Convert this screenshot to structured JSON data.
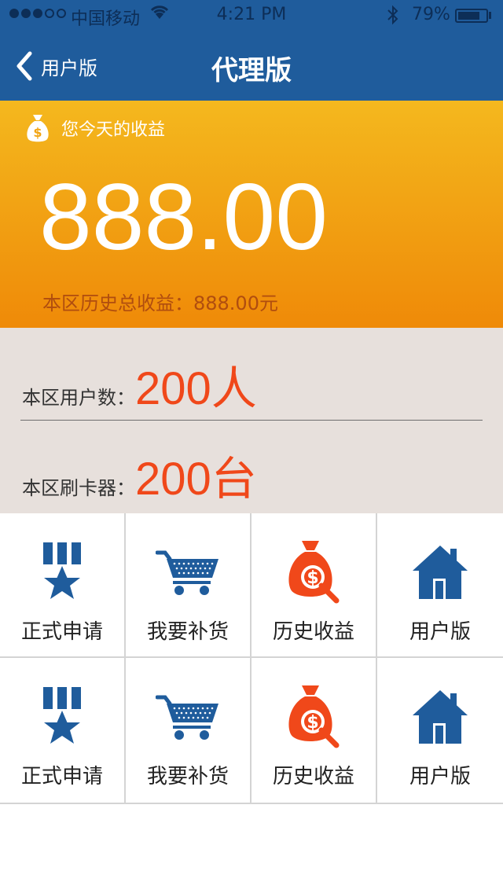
{
  "status": {
    "carrier": "中国移动",
    "time": "4:21 PM",
    "battery": "79%",
    "battery_level": 0.79,
    "signal_bars": 3
  },
  "nav": {
    "back_label": "用户版",
    "title": "代理版"
  },
  "earnings": {
    "header": "您今天的收益",
    "amount": "888.00",
    "history": "本区历史总收益：888.00元"
  },
  "stats": [
    {
      "label": "本区用户数：",
      "value": "200人"
    },
    {
      "label": "本区刷卡器：",
      "value": "200台"
    }
  ],
  "grid": [
    {
      "label": "正式申请",
      "icon": "medal-star-icon"
    },
    {
      "label": "我要补货",
      "icon": "shopping-cart-icon"
    },
    {
      "label": "历史收益",
      "icon": "money-bag-search-icon"
    },
    {
      "label": "用户版",
      "icon": "house-icon"
    },
    {
      "label": "正式申请",
      "icon": "medal-star-icon"
    },
    {
      "label": "我要补货",
      "icon": "shopping-cart-icon"
    },
    {
      "label": "历史收益",
      "icon": "money-bag-search-icon"
    },
    {
      "label": "用户版",
      "icon": "house-icon"
    }
  ],
  "colors": {
    "nav": "#1f5c9c",
    "earn_top": "#f4b81e",
    "earn_bottom": "#ef8a08",
    "accent": "#f0481a",
    "icon_blue": "#1f5c9c"
  }
}
